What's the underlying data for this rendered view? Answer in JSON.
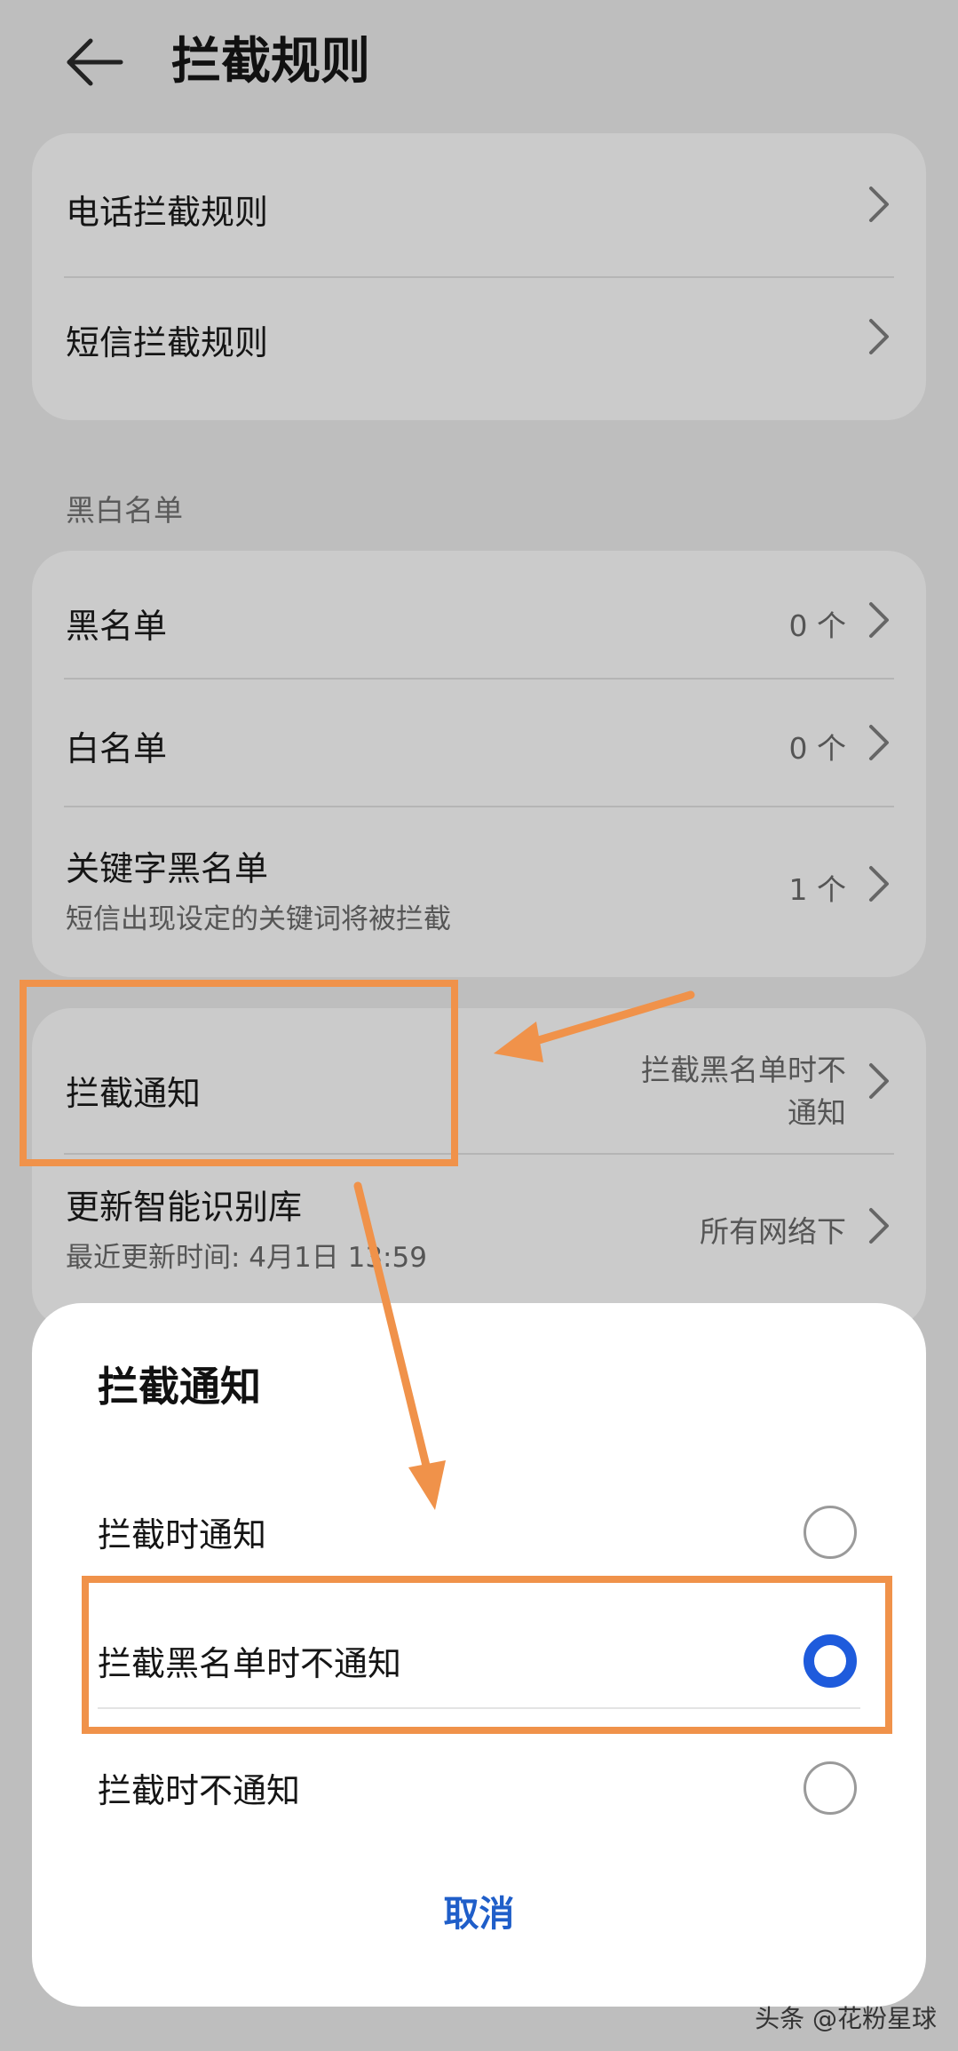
{
  "header": {
    "title": "拦截规则",
    "back_icon": "back-arrow-icon"
  },
  "rules_card": {
    "items": [
      {
        "label": "电话拦截规则"
      },
      {
        "label": "短信拦截规则"
      }
    ]
  },
  "lists_section": {
    "label": "黑白名单",
    "items": [
      {
        "label": "黑名单",
        "value": "0 个"
      },
      {
        "label": "白名单",
        "value": "0 个"
      },
      {
        "label": "关键字黑名单",
        "sublabel": "短信出现设定的关键词将被拦截",
        "value": "1 个"
      }
    ]
  },
  "settings_card": {
    "items": [
      {
        "label": "拦截通知",
        "value_line1": "拦截黑名单时不",
        "value_line2": "通知"
      },
      {
        "label": "更新智能识别库",
        "sublabel": "最近更新时间: 4月1日 13:59",
        "value": "所有网络下"
      }
    ]
  },
  "dialog": {
    "title": "拦截通知",
    "options": [
      {
        "label": "拦截时通知",
        "selected": false
      },
      {
        "label": "拦截黑名单时不通知",
        "selected": true
      },
      {
        "label": "拦截时不通知",
        "selected": false
      }
    ],
    "cancel_label": "取消"
  },
  "colors": {
    "accent": "#1e5bdc",
    "annotation": "#f0924a"
  },
  "watermark": "头条 @花粉星球"
}
